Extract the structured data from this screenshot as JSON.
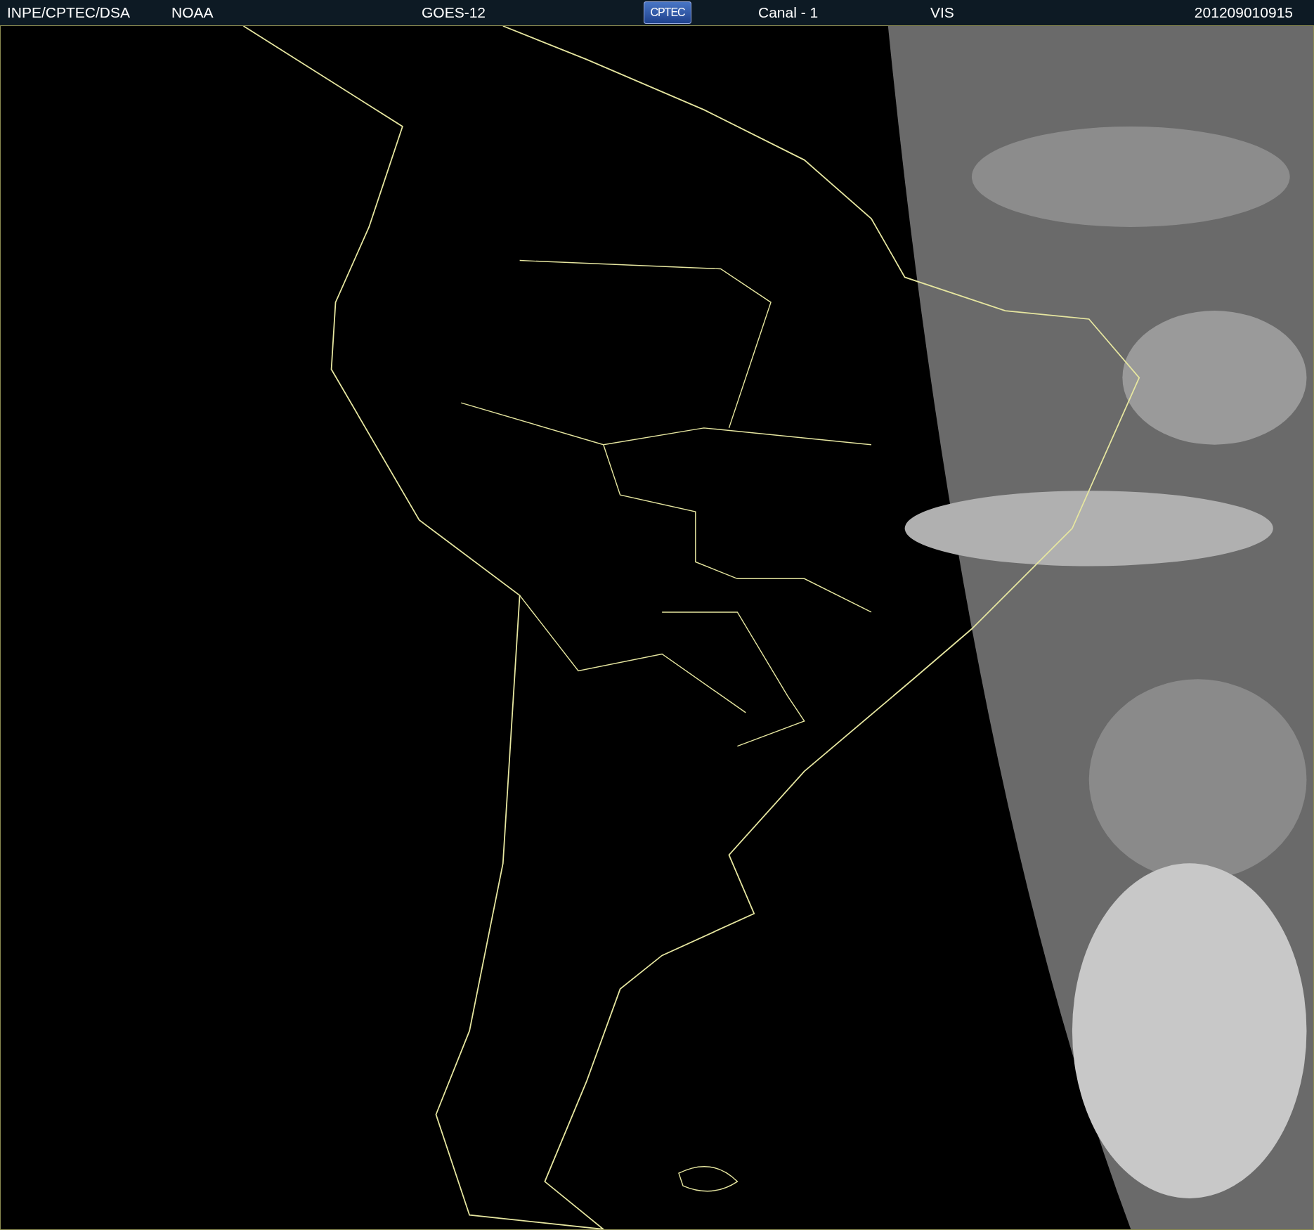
{
  "header": {
    "source": "INPE/CPTEC/DSA",
    "agency": "NOAA",
    "satellite": "GOES-12",
    "logo": "CPTEC",
    "channel": "Canal - 1",
    "band": "VIS",
    "timestamp": "201209010915"
  }
}
